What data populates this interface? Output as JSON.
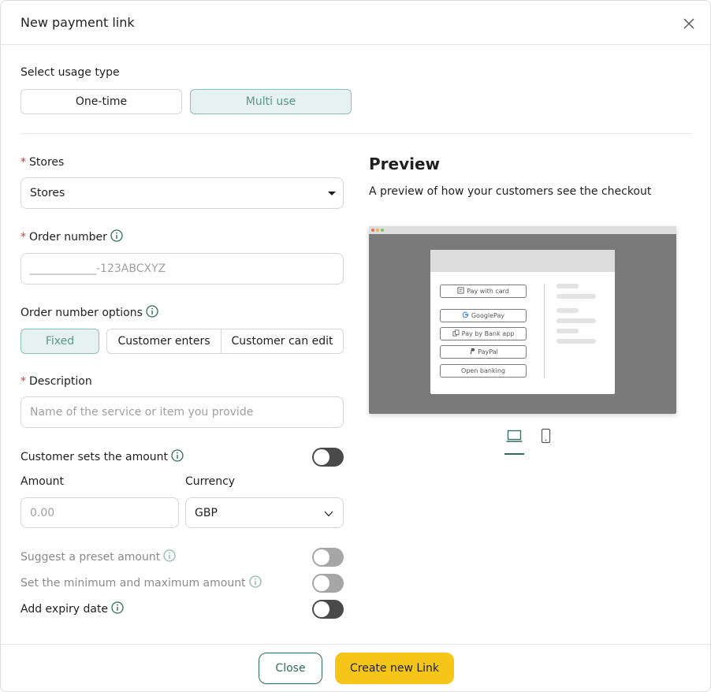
{
  "header": {
    "title": "New payment link"
  },
  "usage": {
    "label": "Select usage type",
    "options": [
      "One-time",
      "Multi use"
    ],
    "selected": "Multi use"
  },
  "stores": {
    "label": "Stores",
    "value": "Stores"
  },
  "order_number": {
    "label": "Order number",
    "placeholder": "____________-123ABCXYZ"
  },
  "order_options": {
    "label": "Order number options",
    "options": [
      "Fixed",
      "Customer enters",
      "Customer can edit"
    ],
    "selected": "Fixed"
  },
  "description": {
    "label": "Description",
    "placeholder": "Name of the service or item you provide"
  },
  "customer_sets_amount": {
    "label": "Customer sets the amount",
    "enabled": false
  },
  "amount": {
    "label": "Amount",
    "placeholder": "0.00"
  },
  "currency": {
    "label": "Currency",
    "value": "GBP"
  },
  "preset_amount": {
    "label": "Suggest a preset amount",
    "enabled": false
  },
  "min_max": {
    "label": "Set the minimum and maximum amount",
    "enabled": false
  },
  "expiry": {
    "label": "Add expiry date",
    "enabled": false
  },
  "preview": {
    "title": "Preview",
    "subtitle": "A preview of how your customers see the checkout",
    "buttons": [
      "Pay with card",
      "GooglePay",
      "Pay by Bank app",
      "PayPal",
      "Open banking"
    ],
    "devices": [
      "laptop-icon",
      "mobile-icon"
    ],
    "selected_device": "laptop-icon"
  },
  "footer": {
    "close_label": "Close",
    "create_label": "Create new Link"
  },
  "colors": {
    "accent": "#2f6b5c",
    "primary_button": "#f5c518",
    "selected_bg": "#e6f2ef",
    "required": "#d93a3a"
  }
}
